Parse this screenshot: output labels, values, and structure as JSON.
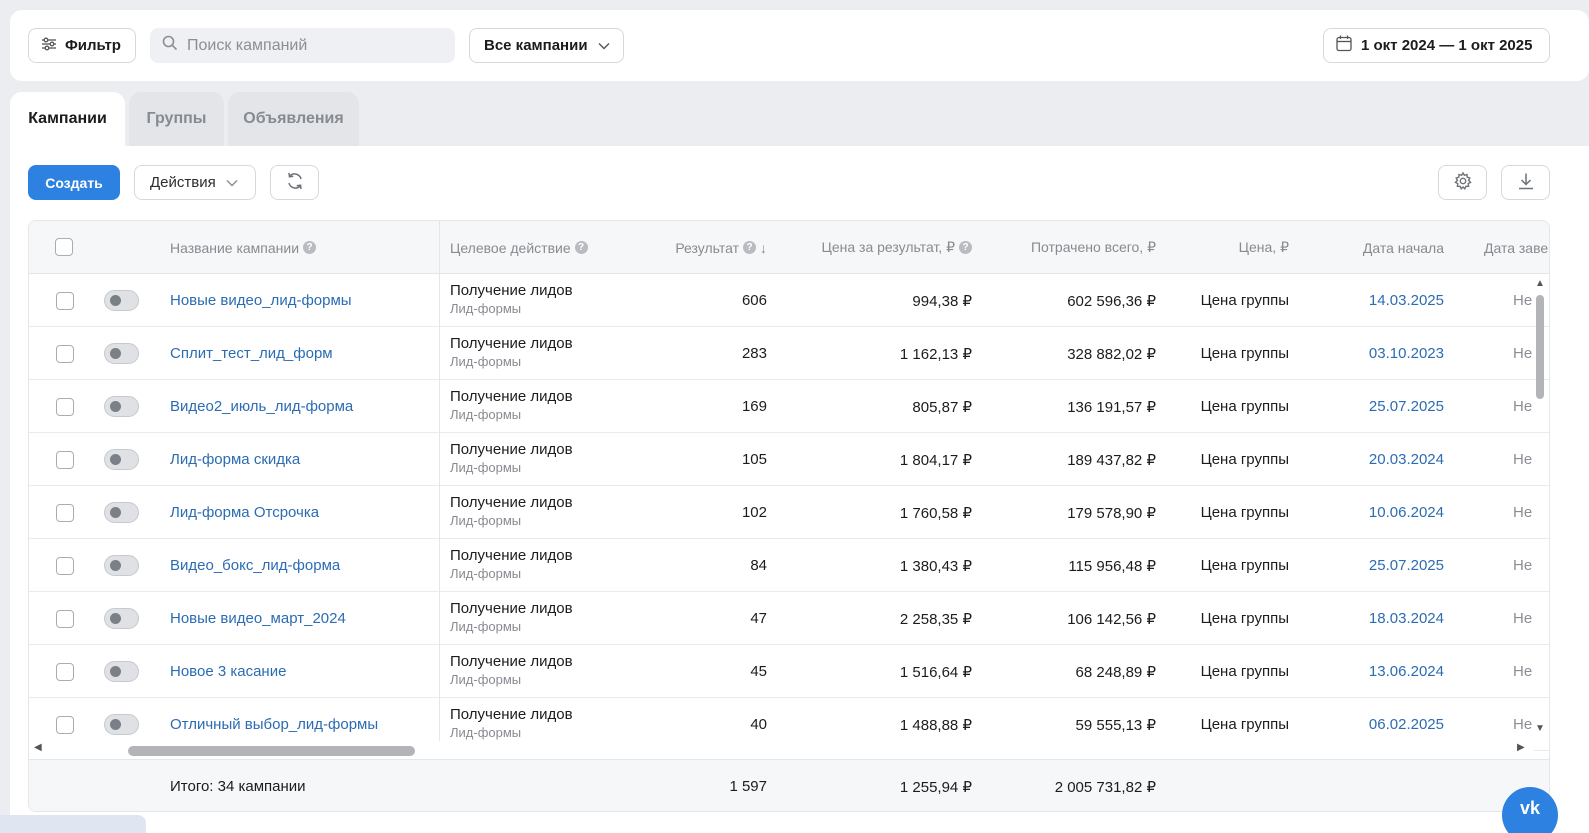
{
  "toolbar": {
    "filter_label": "Фильтр",
    "search_placeholder": "Поиск кампаний",
    "campaign_select": "Все кампании",
    "date_range": "1 окт 2024 — 1 окт 2025"
  },
  "tabs": [
    {
      "label": "Кампании",
      "active": true
    },
    {
      "label": "Группы",
      "active": false
    },
    {
      "label": "Объявления",
      "active": false
    }
  ],
  "actions": {
    "create_label": "Создать",
    "actions_label": "Действия"
  },
  "columns": {
    "name": "Название кампании",
    "goal": "Целевое действие",
    "result": "Результат",
    "result_sort": "↓",
    "cpr": "Цена за результат, ₽",
    "spent": "Потрачено всего, ₽",
    "price": "Цена, ₽",
    "start": "Дата начала",
    "end": "Дата заве"
  },
  "rows": [
    {
      "name": "Новые видео_лид-формы",
      "goal": "Получение лидов",
      "goal_sub": "Лид-формы",
      "result": "606",
      "cpr": "994,38 ₽",
      "spent": "602 596,36 ₽",
      "price": "Цена группы",
      "start": "14.03.2025",
      "end": "Не"
    },
    {
      "name": "Сплит_тест_лид_форм",
      "goal": "Получение лидов",
      "goal_sub": "Лид-формы",
      "result": "283",
      "cpr": "1 162,13 ₽",
      "spent": "328 882,02 ₽",
      "price": "Цена группы",
      "start": "03.10.2023",
      "end": "Не"
    },
    {
      "name": "Видео2_июль_лид-форма",
      "goal": "Получение лидов",
      "goal_sub": "Лид-формы",
      "result": "169",
      "cpr": "805,87 ₽",
      "spent": "136 191,57 ₽",
      "price": "Цена группы",
      "start": "25.07.2025",
      "end": "Не"
    },
    {
      "name": "Лид-форма скидка",
      "goal": "Получение лидов",
      "goal_sub": "Лид-формы",
      "result": "105",
      "cpr": "1 804,17 ₽",
      "spent": "189 437,82 ₽",
      "price": "Цена группы",
      "start": "20.03.2024",
      "end": "Не"
    },
    {
      "name": "Лид-форма Отсрочка",
      "goal": "Получение лидов",
      "goal_sub": "Лид-формы",
      "result": "102",
      "cpr": "1 760,58 ₽",
      "spent": "179 578,90 ₽",
      "price": "Цена группы",
      "start": "10.06.2024",
      "end": "Не"
    },
    {
      "name": "Видео_бокс_лид-форма",
      "goal": "Получение лидов",
      "goal_sub": "Лид-формы",
      "result": "84",
      "cpr": "1 380,43 ₽",
      "spent": "115 956,48 ₽",
      "price": "Цена группы",
      "start": "25.07.2025",
      "end": "Не"
    },
    {
      "name": "Новые видео_март_2024",
      "goal": "Получение лидов",
      "goal_sub": "Лид-формы",
      "result": "47",
      "cpr": "2 258,35 ₽",
      "spent": "106 142,56 ₽",
      "price": "Цена группы",
      "start": "18.03.2024",
      "end": "Не"
    },
    {
      "name": "Новое 3 касание",
      "goal": "Получение лидов",
      "goal_sub": "Лид-формы",
      "result": "45",
      "cpr": "1 516,64 ₽",
      "spent": "68 248,89 ₽",
      "price": "Цена группы",
      "start": "13.06.2024",
      "end": "Не"
    },
    {
      "name": "Отличный выбор_лид-формы",
      "goal": "Получение лидов",
      "goal_sub": "Лид-формы",
      "result": "40",
      "cpr": "1 488,88 ₽",
      "spent": "59 555,13 ₽",
      "price": "Цена группы",
      "start": "06.02.2025",
      "end": "Не"
    }
  ],
  "totals": {
    "label": "Итого: 34 кампании",
    "result": "1 597",
    "cpr": "1 255,94 ₽",
    "spent": "2 005 731,82 ₽"
  },
  "colors": {
    "accent": "#2d81e0",
    "link": "#2b6cb3",
    "background": "#ebedf0"
  }
}
